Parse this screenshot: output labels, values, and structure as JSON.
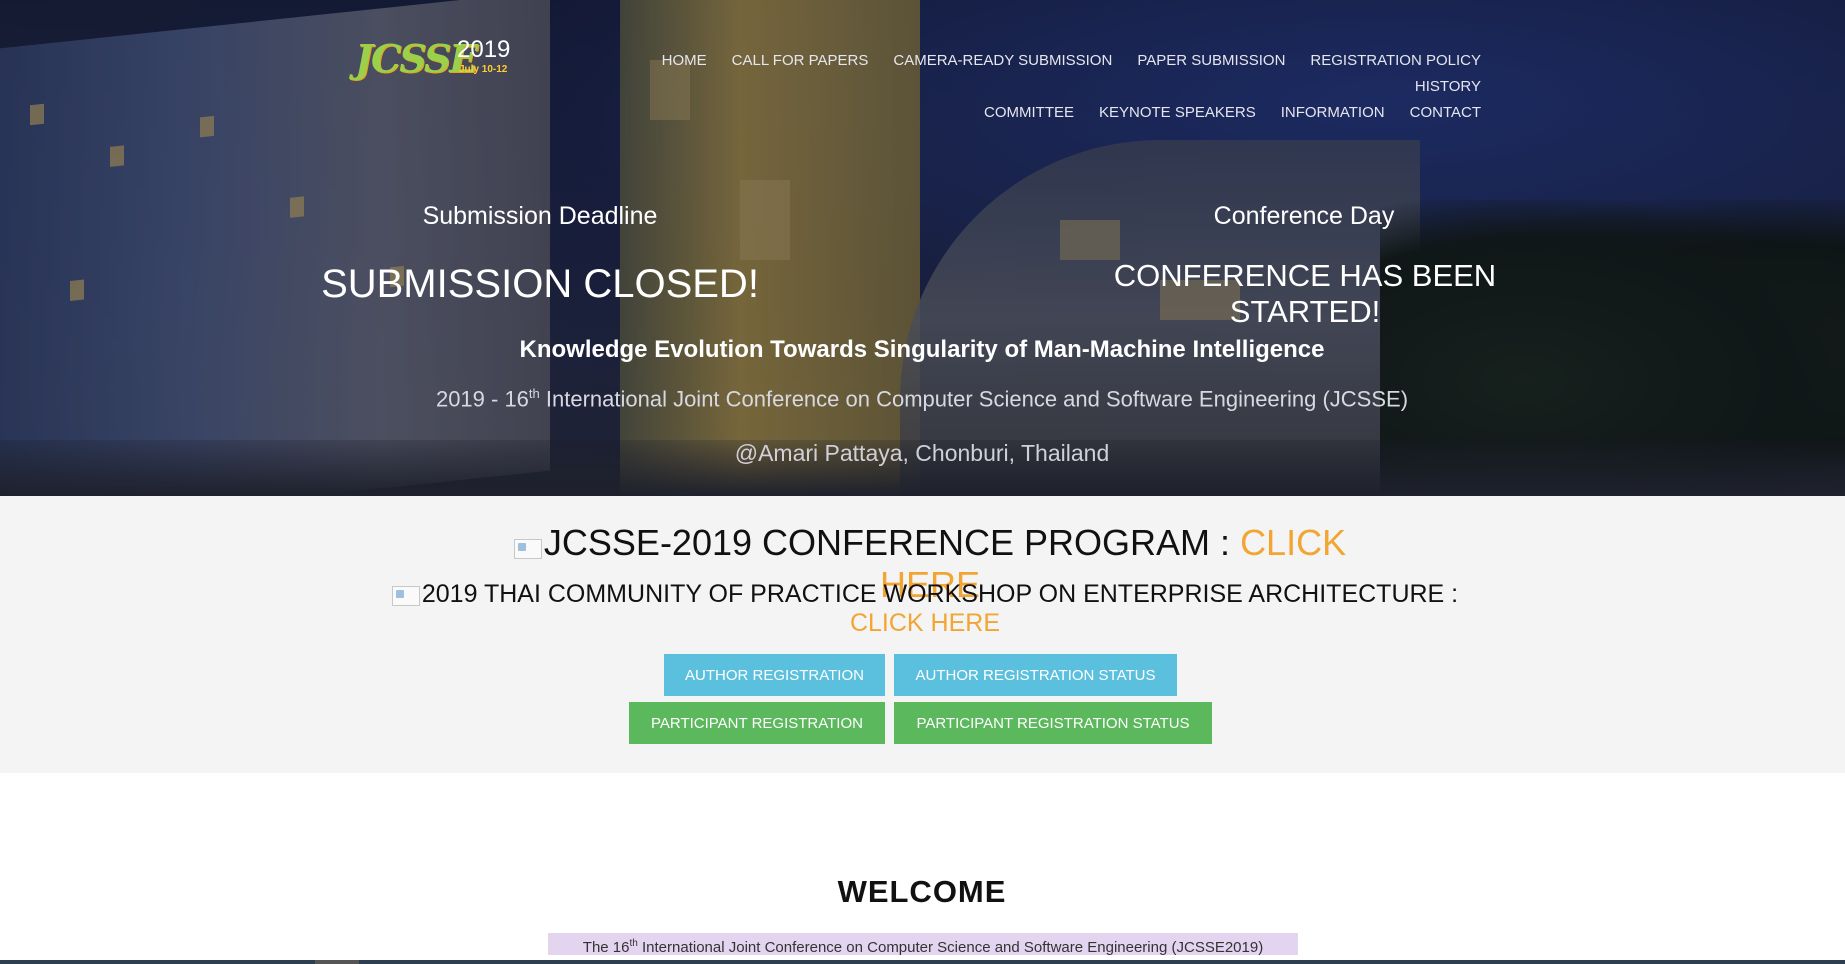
{
  "logo": {
    "brand": "JCSSE",
    "year": "2019",
    "dates": "July 10-12"
  },
  "nav": {
    "items": [
      "HOME",
      "CALL FOR PAPERS",
      "CAMERA-READY SUBMISSION",
      "PAPER SUBMISSION",
      "REGISTRATION POLICY",
      "HISTORY",
      "COMMITTEE",
      "KEYNOTE SPEAKERS",
      "INFORMATION",
      "CONTACT"
    ]
  },
  "hero": {
    "deadline_label": "Submission Deadline",
    "deadline_status": "SUBMISSION CLOSED!",
    "conference_label": "Conference Day",
    "conference_status": "CONFERENCE HAS BEEN STARTED!",
    "theme": "Knowledge Evolution Towards Singularity of Man-Machine Intelligence",
    "conf_prefix": "2019 - 16",
    "conf_sup": "th",
    "conf_suffix": " International Joint Conference on Computer Science and Software Engineering (JCSSE)",
    "venue": "@Amari Pattaya, Chonburi, Thailand"
  },
  "program": {
    "line1_text": "JCSSE-2019 CONFERENCE PROGRAM : ",
    "line1_link": "CLICK HERE",
    "line2_text": "2019 THAI COMMUNITY OF PRACTICE WORKSHOP ON ENTERPRISE ARCHITECTURE : ",
    "line2_link": "CLICK HERE"
  },
  "buttons": {
    "author_registration": "AUTHOR REGISTRATION",
    "author_registration_status": "AUTHOR REGISTRATION STATUS",
    "participant_registration": "PARTICIPANT REGISTRATION",
    "participant_registration_status": "PARTICIPANT REGISTRATION STATUS"
  },
  "welcome": {
    "title": "WELCOME",
    "intro_prefix": "The 16",
    "intro_sup": "th",
    "intro_suffix": " International Joint Conference on Computer Science and Software Engineering (JCSSE2019)"
  },
  "colors": {
    "accent": "#f2a532",
    "blue_button": "#5bc0de",
    "green_button": "#5cb85c"
  }
}
